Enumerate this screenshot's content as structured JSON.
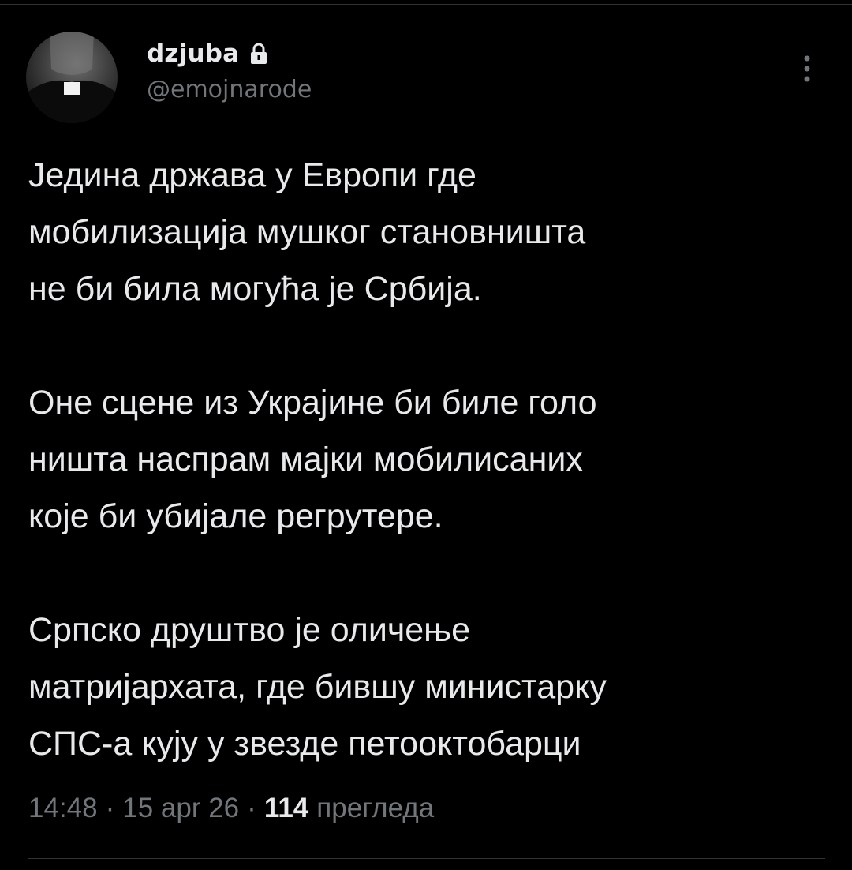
{
  "tweet": {
    "author": {
      "display_name": "dzjuba",
      "handle": "@emojnarode",
      "protected_icon": "lock-icon"
    },
    "menu_icon": "more-vertical-icon",
    "paragraphs": [
      [
        "Једина држава у Европи где",
        "мобилизација мушког становништа",
        "не би била могућа је Србија."
      ],
      [
        "Оне сцене из Украјине би биле голо",
        "ништа наспрам мајки мобилисаних",
        "које би убијале регрутере."
      ],
      [
        "Српско друштво је оличење",
        "матријархата, где бившу министарку",
        "СПС-а кују у звезде петооктобарци"
      ]
    ],
    "meta": {
      "time": "14:48",
      "date": "15 apr 26",
      "views_count": "114",
      "views_label": "прегледа",
      "separator": "·"
    }
  },
  "colors": {
    "background": "#000000",
    "text_primary": "#e7e9ea",
    "text_secondary": "#71767b",
    "divider": "#2f3336"
  }
}
